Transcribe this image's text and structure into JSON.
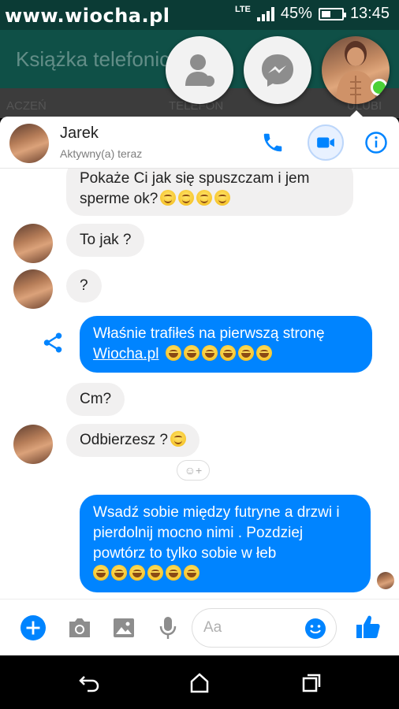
{
  "statusbar": {
    "watermark": "www.wiocha.pl",
    "network": "LTE",
    "battery": "45%",
    "battery_level": 0.45,
    "time": "13:45"
  },
  "background_app": {
    "title": "Książka telefonic",
    "tabs": [
      "ACZEŃ",
      "TELEFON",
      "ULUBI"
    ]
  },
  "chat": {
    "contact_name": "Jarek",
    "contact_status": "Aktywny(a) teraz",
    "accent": "#0084ff",
    "messages": [
      {
        "dir": "in",
        "text": "Pokaże Ci jak się spuszczam i jem sperme ok?",
        "emoji": [
          "smile",
          "smile",
          "smile",
          "smile"
        ]
      },
      {
        "dir": "in",
        "text": "To jak ?",
        "emoji": []
      },
      {
        "dir": "in",
        "text": "?",
        "emoji": []
      },
      {
        "dir": "out",
        "text": "Właśnie trafiłeś na pierwszą stronę",
        "link": "Wiocha.pl",
        "emoji": [
          "laugh",
          "laugh",
          "laugh",
          "laugh",
          "laugh",
          "laugh"
        ]
      },
      {
        "dir": "in",
        "text": "Cm?",
        "emoji": []
      },
      {
        "dir": "in",
        "text": "Odbierzesz ?",
        "emoji": [
          "smile"
        ]
      },
      {
        "dir": "out",
        "text": "Wsadź sobie między futryne a drzwi i pierdolnij mocno nimi . Pozdziej powtórz to tylko sobie w łeb",
        "emoji": [
          "laugh",
          "laugh",
          "laugh",
          "laugh",
          "laugh",
          "laugh"
        ]
      }
    ]
  },
  "composer": {
    "placeholder": "Aa"
  }
}
